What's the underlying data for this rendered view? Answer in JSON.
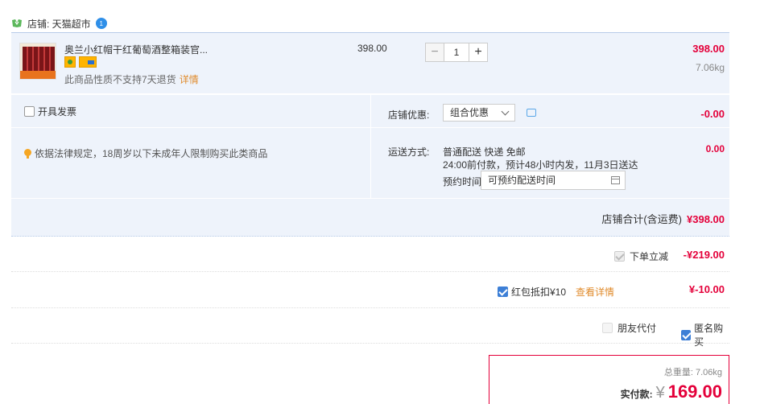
{
  "shop": {
    "label": "店铺: 天猫超市",
    "badge": "1"
  },
  "item": {
    "title": "奥兰小红帽干红葡萄酒整箱装官...",
    "note": "此商品性质不支持7天退货",
    "note_link": "详情",
    "unit_price": "398.00",
    "qty_minus": "−",
    "qty_value": "1",
    "qty_plus": "+",
    "total": "398.00",
    "weight": "7.06kg"
  },
  "options": {
    "invoice_label": "开具发票",
    "legal_notice": "依据法律规定，18周岁以下未成年人限制购买此类商品",
    "promo_label": "店铺优惠:",
    "promo_value": "组合优惠",
    "promo_amount": "-0.00",
    "ship_label": "运送方式:",
    "ship_line1": "普通配送 快递 免邮",
    "ship_line2": "24:00前付款，预计48小时内发，11月3日送达",
    "ship_fee": "0.00",
    "appt_label": "预约时间",
    "appt_placeholder": "可预约配送时间"
  },
  "shop_total": {
    "label": "店铺合计(含运费)",
    "amount": "¥398.00"
  },
  "discount": {
    "label": "下单立减",
    "amount": "-¥219.00"
  },
  "redpack": {
    "label": "红包抵扣¥10",
    "link": "查看详情",
    "amount": "¥-10.00"
  },
  "extra": {
    "friend_pay": "朋友代付",
    "anonymous": "匿名购买"
  },
  "payment": {
    "weight": "总重量: 7.06kg",
    "label": "实付款:",
    "yen": "¥",
    "amount": "169.00"
  },
  "colors": {
    "accent_red": "#e4003a",
    "link_orange": "#e08b2c",
    "panel_blue": "#eef3fb",
    "check_blue": "#3d7fd6"
  },
  "icons": {
    "shop": "tmall-shop-icon",
    "bulb": "bulb-icon",
    "chat": "chat-icon",
    "calendar": "calendar-icon",
    "chevron": "chevron-down-icon"
  }
}
